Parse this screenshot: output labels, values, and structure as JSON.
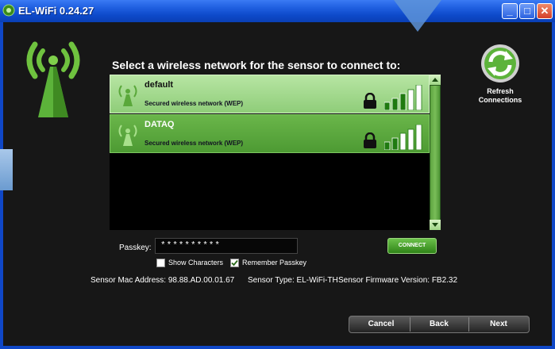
{
  "window": {
    "title": "EL-WiFi 0.24.27"
  },
  "main": {
    "heading": "Select a wireless network for the sensor to connect to:",
    "networks": [
      {
        "name": "default",
        "security": "Secured wireless network (WEP)",
        "selected": true,
        "signal_bars": 5,
        "signal_filled": 3
      },
      {
        "name": "DATAQ",
        "security": "Secured wireless network (WEP)",
        "selected": false,
        "signal_bars": 5,
        "signal_filled": 2
      }
    ],
    "refresh": {
      "line1": "Refresh",
      "line2": "Connections"
    },
    "passkey": {
      "label": "Passkey:",
      "value": "**********"
    },
    "connect_label": "CONNECT",
    "show_characters": {
      "label": "Show Characters",
      "checked": false
    },
    "remember_passkey": {
      "label": "Remember Passkey",
      "checked": true
    },
    "info": {
      "mac": "Sensor Mac Address: 98.88.AD.00.01.67",
      "type": "Sensor Type: EL-WiFi-TH",
      "firmware": "Sensor Firmware Version: FB2.32"
    }
  },
  "footer": {
    "cancel": "Cancel",
    "back": "Back",
    "next": "Next"
  },
  "colors": {
    "accent_green": "#5cb33a",
    "selected_row": "#a8dc92",
    "titlebar": "#1f5fe0"
  },
  "icons": [
    "wifi-logo-icon",
    "refresh-icon",
    "lock-icon",
    "signal-bars-icon",
    "wifi-small-icon",
    "check-icon"
  ]
}
